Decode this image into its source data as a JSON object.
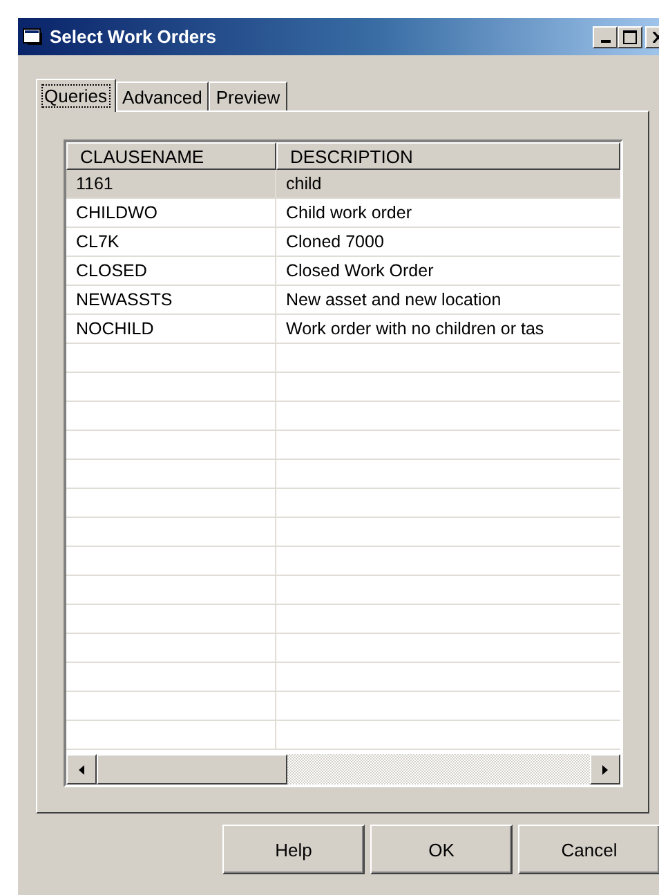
{
  "window": {
    "title": "Select Work Orders"
  },
  "tabs": [
    {
      "label": "Queries",
      "selected": true
    },
    {
      "label": "Advanced",
      "selected": false
    },
    {
      "label": "Preview",
      "selected": false
    }
  ],
  "table": {
    "columns": [
      "CLAUSENAME",
      "DESCRIPTION"
    ],
    "rows": [
      {
        "cells": [
          "1161",
          "child"
        ],
        "selected": true
      },
      {
        "cells": [
          "CHILDWO",
          "Child work order"
        ],
        "selected": false
      },
      {
        "cells": [
          "CL7K",
          "Cloned 7000"
        ],
        "selected": false
      },
      {
        "cells": [
          "CLOSED",
          "Closed Work Order"
        ],
        "selected": false
      },
      {
        "cells": [
          "NEWASSTS",
          "New asset and new location"
        ],
        "selected": false
      },
      {
        "cells": [
          "NOCHILD",
          "Work order with no children or tas"
        ],
        "selected": false
      }
    ]
  },
  "buttons": [
    "Help",
    "OK",
    "Cancel"
  ]
}
